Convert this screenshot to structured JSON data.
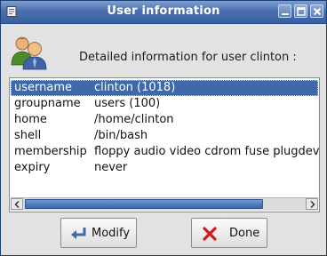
{
  "window": {
    "title": "User information"
  },
  "header": {
    "text": "Detailed information for user clinton :"
  },
  "list": {
    "rows": [
      {
        "key": "username",
        "value": "clinton (1018)",
        "selected": true
      },
      {
        "key": "groupname",
        "value": "users (100)"
      },
      {
        "key": "home",
        "value": "/home/clinton"
      },
      {
        "key": "shell",
        "value": "/bin/bash"
      },
      {
        "key": "membership",
        "value": "floppy audio video cdrom fuse plugdev"
      },
      {
        "key": "expiry",
        "value": "never"
      }
    ]
  },
  "buttons": {
    "modify": "Modify",
    "done": "Done"
  },
  "icons": {
    "title_icon": "doc-icon",
    "minimize": "minimize-icon",
    "maximize": "maximize-icon",
    "close": "close-icon",
    "users": "users-icon",
    "modify": "return-arrow-icon",
    "done": "red-x-icon"
  },
  "colors": {
    "selection": "#3f68a8",
    "titlebar": "#4a6fae"
  }
}
